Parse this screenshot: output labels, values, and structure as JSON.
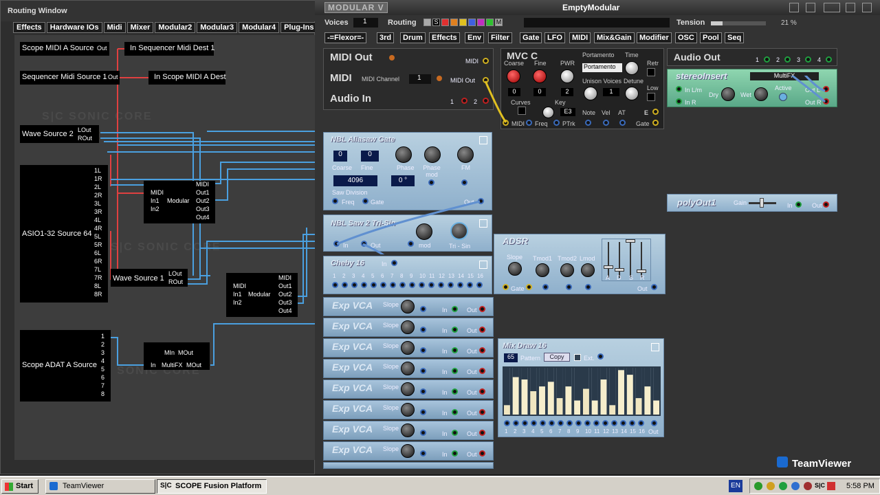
{
  "routing_window": {
    "title": "Routing Window",
    "tabs": [
      "Effects",
      "Hardware IOs",
      "Midi",
      "Mixer",
      "Modular2",
      "Modular3",
      "Modular4",
      "Plug-Ins"
    ],
    "watermark": "S|C SONIC CORE",
    "modules": {
      "scope_midi_a_source": {
        "name": "Scope MIDI A Source",
        "port": "Out"
      },
      "in_sequencer_midi_dest": {
        "name": "In Sequencer Midi Dest 1"
      },
      "sequencer_midi_source": {
        "name": "Sequencer Midi Source 1",
        "port": "Out"
      },
      "in_scope_midi_a_dest": {
        "name": "In Scope MIDI A Dest"
      },
      "wave_source_2": {
        "name": "Wave Source 2",
        "ports": [
          "LOut",
          "ROut"
        ]
      },
      "asio_source": {
        "name": "ASIO1-32 Source 64",
        "ports": [
          "1L",
          "1R",
          "2L",
          "2R",
          "3L",
          "3R",
          "4L",
          "4R",
          "5L",
          "5R",
          "6L",
          "6R",
          "7L",
          "7R",
          "8L",
          "8R"
        ]
      },
      "modular_1": {
        "name": "Modular",
        "inputs": [
          "MIDI",
          "In1",
          "In2"
        ],
        "outputs": [
          "MIDI",
          "Out1",
          "Out2",
          "Out3",
          "Out4"
        ]
      },
      "wave_source_1": {
        "name": "Wave Source 1",
        "ports": [
          "LOut",
          "ROut"
        ]
      },
      "modular_2": {
        "name": "Modular",
        "inputs": [
          "MIDI",
          "In1",
          "In2"
        ],
        "outputs": [
          "MIDI",
          "Out1",
          "Out2",
          "Out3",
          "Out4"
        ]
      },
      "scope_adat_a_source": {
        "name": "Scope ADAT A Source",
        "ports": [
          "1",
          "2",
          "3",
          "4",
          "5",
          "6",
          "7",
          "8"
        ]
      },
      "multifx": {
        "name": "MultiFX",
        "min": "MIn",
        "mout": "MOut",
        "in": "In",
        "out": "MOut"
      }
    }
  },
  "modular_window": {
    "logo": "MODULAR V",
    "title": "EmptyModular",
    "voices_label": "Voices",
    "voices_value": "1",
    "routing_label": "Routing",
    "routing_letters": [
      "S",
      "M"
    ],
    "routing_colors": [
      "#aaaaaa",
      "#000000",
      "#e03030",
      "#e08020",
      "#e0c020",
      "#4060e0",
      "#c030c0",
      "#30c030",
      "#aaaaaa"
    ],
    "tension_label": "Tension",
    "tension_value": "21 %",
    "nav": [
      "-=Flexor=-",
      "3rd",
      "Drum",
      "Effects",
      "Env",
      "Filter",
      "Gate",
      "LFO",
      "MIDI",
      "Mix&Gain",
      "Modifier",
      "OSC",
      "Pool",
      "Seq"
    ],
    "midi_out": {
      "title": "MIDI Out",
      "port": "MIDI"
    },
    "midi": {
      "title": "MIDI",
      "channel_label": "MIDI Channel",
      "channel": "1",
      "port": "MIDI Out"
    },
    "audio_in": {
      "title": "Audio In",
      "ports": [
        "1",
        "2"
      ]
    },
    "mvc": {
      "title": "MVC C",
      "coarse": "Coarse",
      "fine": "Fine",
      "pwr": "PWR",
      "portamento": "Portamento",
      "time": "Time",
      "retr": "Retr",
      "portamento_field": "Portamento",
      "coarse_val": "0",
      "fine_val": "0",
      "pwr_val": "2",
      "unison_voices": "Unison Voices",
      "detune": "Detune",
      "low": "Low",
      "unison_val": "1",
      "curves": "Curves",
      "key": "Key",
      "key_val": "E3",
      "note": "Note",
      "vel": "Vel",
      "at": "AT",
      "e": "E",
      "midi": "MIDI",
      "freq": "Freq",
      "ptrk": "PTrk",
      "gate": "Gate"
    },
    "audio_out": {
      "title": "Audio Out",
      "ports": [
        "1",
        "2",
        "3",
        "4"
      ]
    },
    "stereo_insert": {
      "title": "stereoInsert",
      "fx": "MultiFX",
      "in_lm": "In L/m",
      "in_r": "In R",
      "dry": "Dry",
      "wet": "Wet",
      "active": "Active",
      "out_l": "Out L",
      "out_r": "Out R"
    },
    "aliasaw": {
      "title": "NBL Aliasaw Gate",
      "coarse_val": "0",
      "fine_val": "0",
      "coarse": "Coarse",
      "fine": "Fine",
      "phase": "Phase",
      "phase_mod": "Phase mod",
      "fm": "FM",
      "saw_div_val": "4096",
      "phase_val": "0 °",
      "saw_div": "Saw Division",
      "freq": "Freq",
      "gate": "Gate",
      "out": "Out"
    },
    "polyout": {
      "title": "polyOut1",
      "gain": "Gain",
      "in": "In",
      "out": "Out"
    },
    "saw_tri": {
      "title": "NBL Saw 2 Tri-Sin",
      "in": "In",
      "out": "Out",
      "mod": "mod",
      "trisin": "Tri - Sin"
    },
    "adsr": {
      "title": "ADSR",
      "slope": "Slope",
      "tmod1": "Tmod1",
      "tmod2": "Tmod2",
      "lmod": "Lmod",
      "gate": "Gate",
      "out": "Out",
      "sliders": [
        "A",
        "D",
        "S",
        "R"
      ]
    },
    "cheby": {
      "title": "Cheby 16",
      "in": "In",
      "numbers": [
        "1",
        "2",
        "3",
        "4",
        "5",
        "6",
        "7",
        "8",
        "9",
        "10",
        "11",
        "12",
        "13",
        "14",
        "15",
        "16"
      ]
    },
    "exp_vca": {
      "title": "Exp VCA",
      "slope": "Slope",
      "in": "In",
      "out": "Out",
      "count": 8
    },
    "mix_draw": {
      "title": "Mix Draw 16",
      "pattern_val": "65",
      "pattern": "Pattern",
      "copy": "Copy",
      "ext": "Ext.",
      "out": "Out",
      "numbers": [
        "1",
        "2",
        "3",
        "4",
        "5",
        "6",
        "7",
        "8",
        "9",
        "10",
        "11",
        "12",
        "13",
        "14",
        "15",
        "16"
      ],
      "levels": [
        0.2,
        0.8,
        0.75,
        0.5,
        0.6,
        0.7,
        0.35,
        0.6,
        0.3,
        0.55,
        0.3,
        0.75,
        0.2,
        0.95,
        0.85,
        0.35,
        0.6,
        0.3
      ]
    },
    "teamviewer": "TeamViewer"
  },
  "taskbar": {
    "start": "Start",
    "teamviewer": "TeamViewer",
    "scope": "SCOPE Fusion Platform",
    "lang": "EN",
    "clock": "5:58 PM"
  }
}
